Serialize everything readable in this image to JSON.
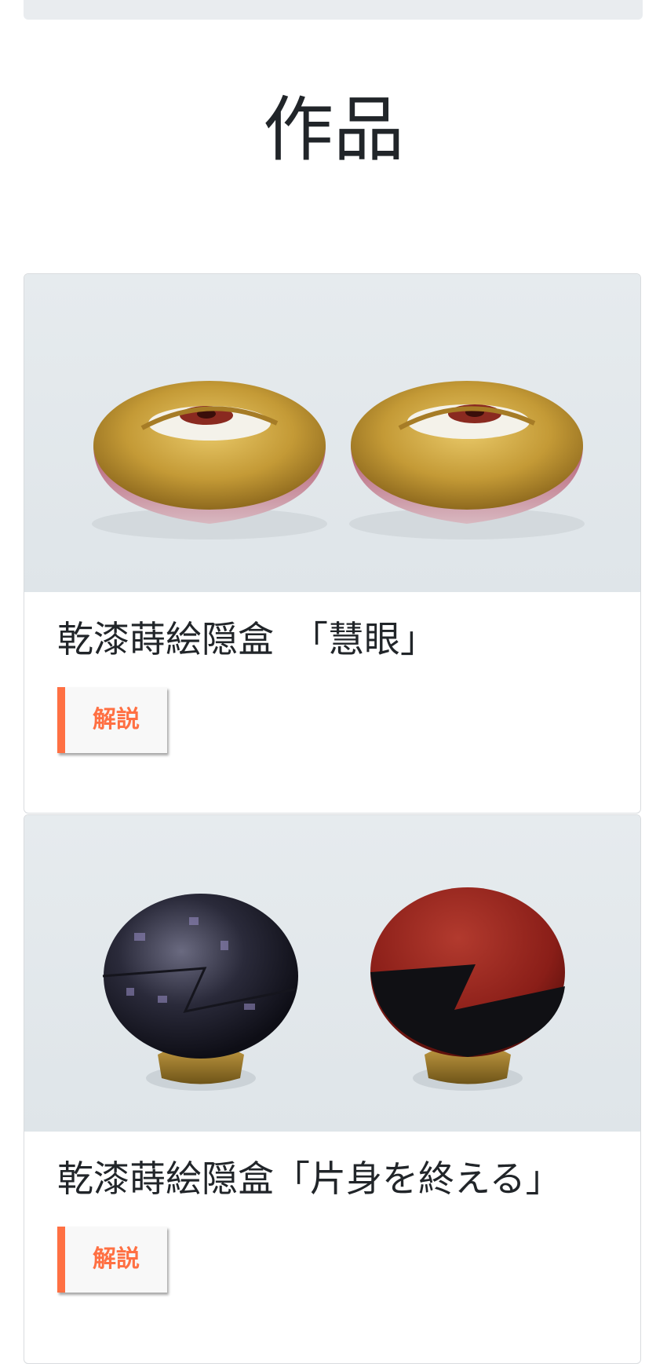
{
  "section": {
    "title": "作品"
  },
  "works": [
    {
      "title": "乾漆蒔絵隠盒　「慧眼」",
      "button_label": "解説"
    },
    {
      "title": "乾漆蒔絵隠盒「片身を終える」",
      "button_label": "解説"
    }
  ],
  "colors": {
    "accent": "#ff7043",
    "title_text": "#212529",
    "top_bar": "#e9ecef"
  }
}
